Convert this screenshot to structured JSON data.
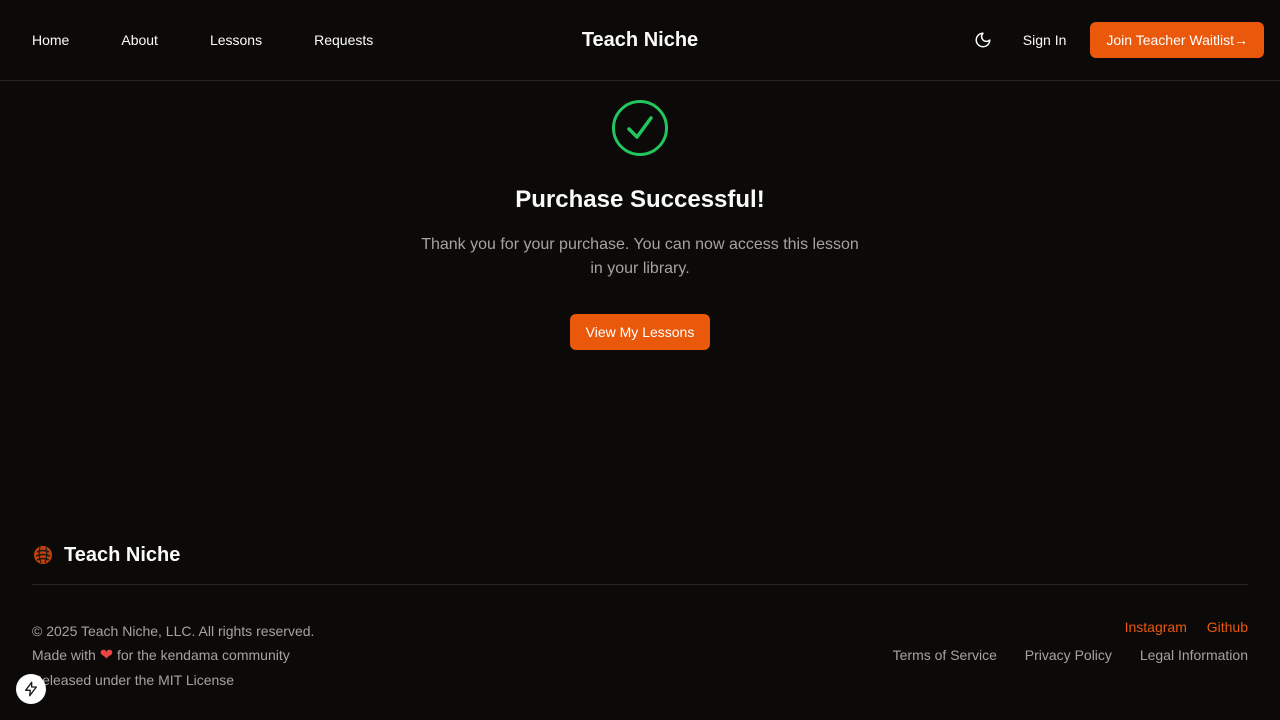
{
  "header": {
    "nav": [
      "Home",
      "About",
      "Lessons",
      "Requests"
    ],
    "brand": "Teach Niche",
    "theme_icon": "moon-icon",
    "signin": "Sign In",
    "waitlist": "Join Teacher Waitlist→"
  },
  "main": {
    "status_icon": "check-circle-icon",
    "title": "Purchase Successful!",
    "message": "Thank you for your purchase. You can now access this lesson in your library.",
    "cta": "View My Lessons"
  },
  "footer": {
    "brand": "Teach Niche",
    "copyright": "© 2025 Teach Niche, LLC. All rights reserved.",
    "made_with_prefix": "Made with",
    "made_with_suffix": "for the kendama community",
    "license": "Released under the MIT License",
    "social": [
      "Instagram",
      "Github"
    ],
    "legal": [
      "Terms of Service",
      "Privacy Policy",
      "Legal Information"
    ]
  },
  "colors": {
    "background": "#0c0a09",
    "accent": "#ea580c",
    "success": "#22c55e",
    "muted_text": "#a8a29e",
    "border": "#292524"
  }
}
